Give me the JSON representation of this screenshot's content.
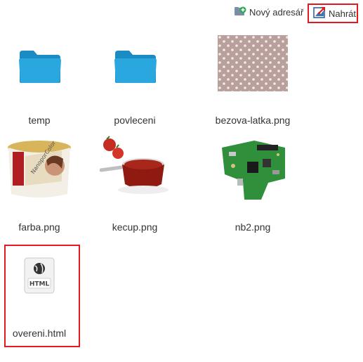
{
  "toolbar": {
    "new_folder_label": "Nový adresář",
    "upload_label": "Nahrát",
    "new_folder_icon": "folder-add-icon",
    "upload_icon": "upload-icon"
  },
  "files": [
    {
      "name": "temp",
      "type": "folder"
    },
    {
      "name": "povleceni",
      "type": "folder"
    },
    {
      "name": "bezova-latka.png",
      "type": "image"
    },
    {
      "name": "farba.png",
      "type": "image"
    },
    {
      "name": "kecup.png",
      "type": "image"
    },
    {
      "name": "nb2.png",
      "type": "image"
    },
    {
      "name": "overeni.html",
      "type": "html",
      "badge": "HTML"
    }
  ],
  "colors": {
    "folder": "#2aa7df",
    "highlight": "#e2191e",
    "fabric": "#b79f9c",
    "pcb": "#2f8f3a"
  }
}
